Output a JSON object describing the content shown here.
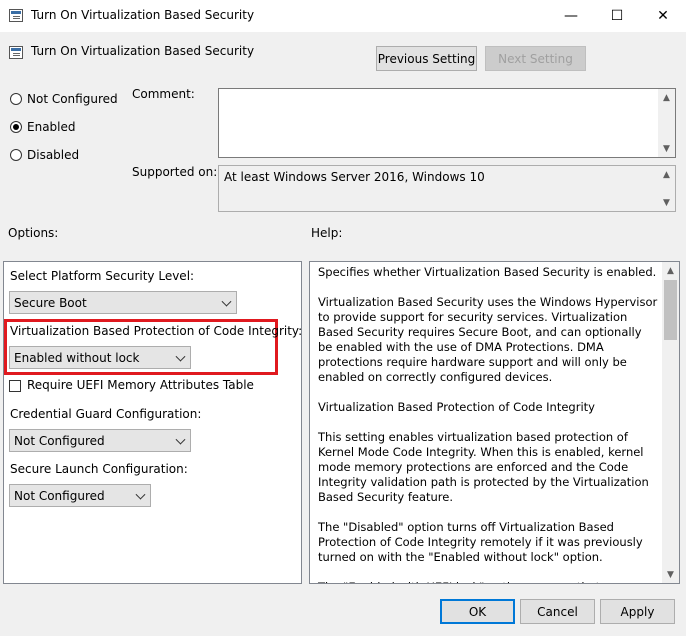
{
  "window": {
    "title": "Turn On Virtualization Based Security",
    "controls": {
      "minimize": "—",
      "maximize": "☐",
      "close": "✕"
    }
  },
  "header": {
    "policy_title": "Turn On Virtualization Based Security",
    "previous_setting": "Previous Setting",
    "next_setting": "Next Setting"
  },
  "state_options": [
    {
      "label": "Not Configured",
      "selected": false
    },
    {
      "label": "Enabled",
      "selected": true
    },
    {
      "label": "Disabled",
      "selected": false
    }
  ],
  "comment": {
    "label": "Comment:",
    "value": ""
  },
  "supported_on": {
    "label": "Supported on:",
    "value": "At least Windows Server 2016, Windows 10"
  },
  "options_label": "Options:",
  "help_label": "Help:",
  "options": {
    "platform_level_label": "Select Platform Security Level:",
    "platform_level_value": "Secure Boot",
    "code_integrity_label": "Virtualization Based Protection of Code Integrity:",
    "code_integrity_value": "Enabled without lock",
    "uefi_table_label": "Require UEFI Memory Attributes Table",
    "uefi_table_checked": false,
    "credential_guard_label": "Credential Guard Configuration:",
    "credential_guard_value": "Not Configured",
    "secure_launch_label": "Secure Launch Configuration:",
    "secure_launch_value": "Not Configured"
  },
  "help": {
    "text": "Specifies whether Virtualization Based Security is enabled.\n\nVirtualization Based Security uses the Windows Hypervisor to provide support for security services. Virtualization Based Security requires Secure Boot, and can optionally be enabled with the use of DMA Protections. DMA protections require hardware support and will only be enabled on correctly configured devices.\n\nVirtualization Based Protection of Code Integrity\n\nThis setting enables virtualization based protection of Kernel Mode Code Integrity. When this is enabled, kernel mode memory protections are enforced and the Code Integrity validation path is protected by the Virtualization Based Security feature.\n\nThe \"Disabled\" option turns off Virtualization Based Protection of Code Integrity remotely if it was previously turned on with the \"Enabled without lock\" option.\n\nThe \"Enabled with UEFI lock\" option ensures that Virtualization"
  },
  "footer": {
    "ok": "OK",
    "cancel": "Cancel",
    "apply": "Apply"
  },
  "colors": {
    "highlight_border": "#e0191f",
    "focus_border": "#0078d7"
  }
}
